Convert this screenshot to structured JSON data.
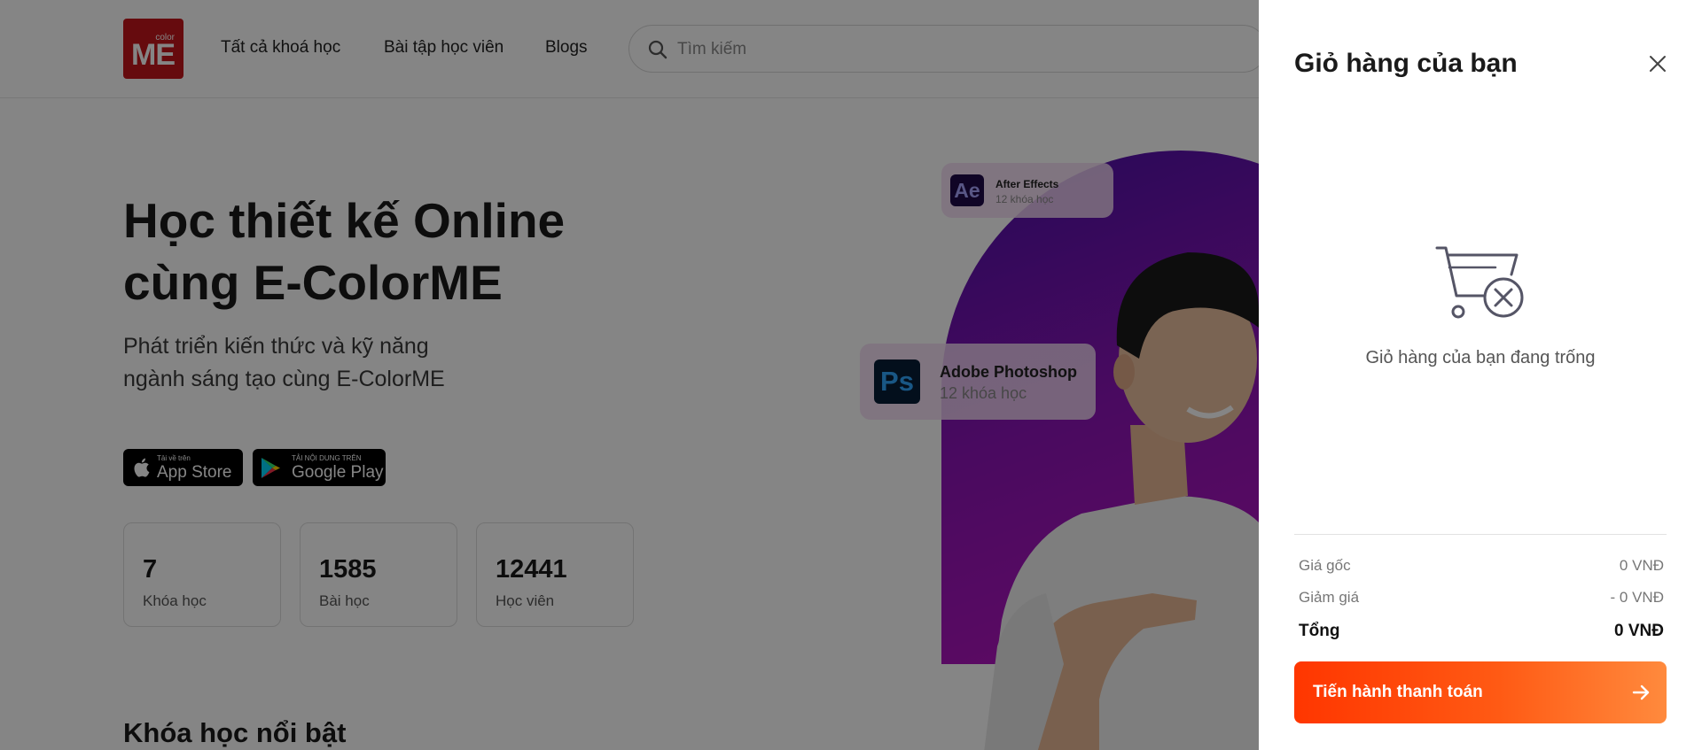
{
  "header": {
    "logo_small": "color",
    "logo_big": "ME",
    "nav": [
      {
        "label": "Tất cả khoá học"
      },
      {
        "label": "Bài tập học viên"
      },
      {
        "label": "Blogs"
      }
    ],
    "search": {
      "placeholder": "Tìm kiếm",
      "icon": "search-icon"
    }
  },
  "hero": {
    "title_line1": "Học thiết kế Online",
    "title_line2": "cùng E-ColorME",
    "subtitle_line1": "Phát triển kiến thức và kỹ năng",
    "subtitle_line2": "ngành sáng tạo cùng E-ColorME",
    "app_store": {
      "small": "Tải về trên",
      "big": "App Store",
      "icon": "apple-icon"
    },
    "google_play": {
      "small": "TẢI NỘI DUNG TRÊN",
      "big": "Google Play",
      "icon": "google-play-icon"
    },
    "stats": [
      {
        "value": "7",
        "label": "Khóa học"
      },
      {
        "value": "1585",
        "label": "Bài học"
      },
      {
        "value": "12441",
        "label": "Học viên"
      }
    ],
    "cards": [
      {
        "badge": "Ae",
        "title": "After Effects",
        "sub": "12 khóa học",
        "badge_bg": "#1f0a4a",
        "badge_color": "#a9a6ff"
      },
      {
        "badge": "Ps",
        "title": "Adobe Photoshop",
        "sub": "12 khóa học",
        "badge_bg": "#061e36",
        "badge_color": "#31a8ff"
      }
    ],
    "featured_heading": "Khóa học nổi bật"
  },
  "cart": {
    "title": "Giỏ hàng của bạn",
    "empty_text": "Giỏ hàng của bạn đang trống",
    "rows": [
      {
        "label": "Giá gốc",
        "value": "0 VNĐ"
      },
      {
        "label": "Giảm giá",
        "value": "- 0 VNĐ"
      }
    ],
    "total": {
      "label": "Tổng",
      "value": "0 VNĐ"
    },
    "checkout_label": "Tiến hành thanh toán",
    "colors": {
      "accent_start": "#ff3600",
      "accent_end": "#ff8a3d"
    }
  }
}
